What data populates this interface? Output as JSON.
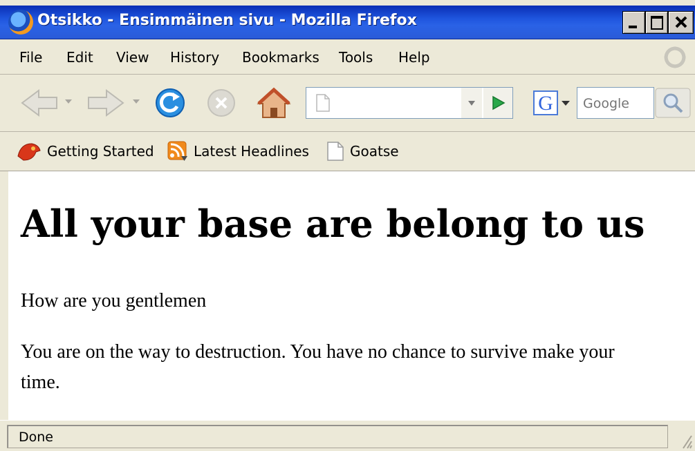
{
  "window": {
    "title": "Otsikko - Ensimmäinen sivu - Mozilla Firefox",
    "titlebar_color": "#1f55de"
  },
  "menu": {
    "items": [
      {
        "label": "File"
      },
      {
        "label": "Edit"
      },
      {
        "label": "View"
      },
      {
        "label": "History"
      },
      {
        "label": "Bookmarks"
      },
      {
        "label": "Tools"
      },
      {
        "label": "Help"
      }
    ]
  },
  "navigation": {
    "url_value": "",
    "search_engine": "Google",
    "search_placeholder": "Google"
  },
  "bookmarks": [
    {
      "label": "Getting Started",
      "icon": "firefox-bookmark-icon"
    },
    {
      "label": "Latest Headlines",
      "icon": "rss-feed-icon"
    },
    {
      "label": "Goatse",
      "icon": "page-icon"
    }
  ],
  "page": {
    "heading": "All your base are belong to us",
    "paragraph1": "How are you gentlemen",
    "paragraph2": "You are on the way to destruction. You have no chance to survive make your time."
  },
  "status": {
    "text": "Done"
  }
}
